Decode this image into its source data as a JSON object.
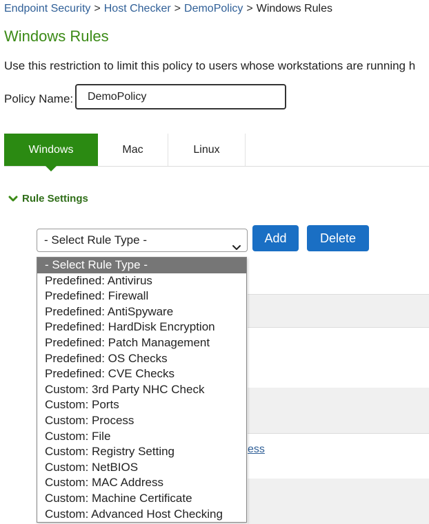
{
  "breadcrumb": {
    "items": [
      "Endpoint Security",
      "Host Checker",
      "DemoPolicy"
    ],
    "separator": ">",
    "current": "Windows Rules"
  },
  "page_title": "Windows Rules",
  "description": "Use this restriction to limit this policy to users whose workstations are running h",
  "policy": {
    "label": "Policy Name:",
    "value": "DemoPolicy"
  },
  "tabs": [
    {
      "label": "Windows",
      "active": true
    },
    {
      "label": "Mac",
      "active": false
    },
    {
      "label": "Linux",
      "active": false
    }
  ],
  "rule_settings": {
    "label": "Rule Settings",
    "icon": "chevron-down-icon"
  },
  "rule_type_select": {
    "selected": "- Select Rule Type -",
    "icon": "chevron-down-icon",
    "options": [
      "- Select Rule Type -",
      "Predefined: Antivirus",
      "Predefined: Firewall",
      "Predefined: AntiSpyware",
      "Predefined: HardDisk Encryption",
      "Predefined: Patch Management",
      "Predefined: OS Checks",
      "Predefined: CVE Checks",
      "Custom: 3rd Party NHC Check",
      "Custom: Ports",
      "Custom: Process",
      "Custom: File",
      "Custom: Registry Setting",
      "Custom: NetBIOS",
      "Custom: MAC Address",
      "Custom: Machine Certificate",
      "Custom: Advanced Host Checking"
    ]
  },
  "buttons": {
    "add": "Add",
    "delete": "Delete"
  },
  "partial_link_text": "ess",
  "colors": {
    "accent_green": "#2b8a12",
    "title_green": "#3b8a16",
    "button_blue": "#1a6fc4",
    "link_blue": "#2f5f97",
    "selected_option_bg": "#767676"
  }
}
